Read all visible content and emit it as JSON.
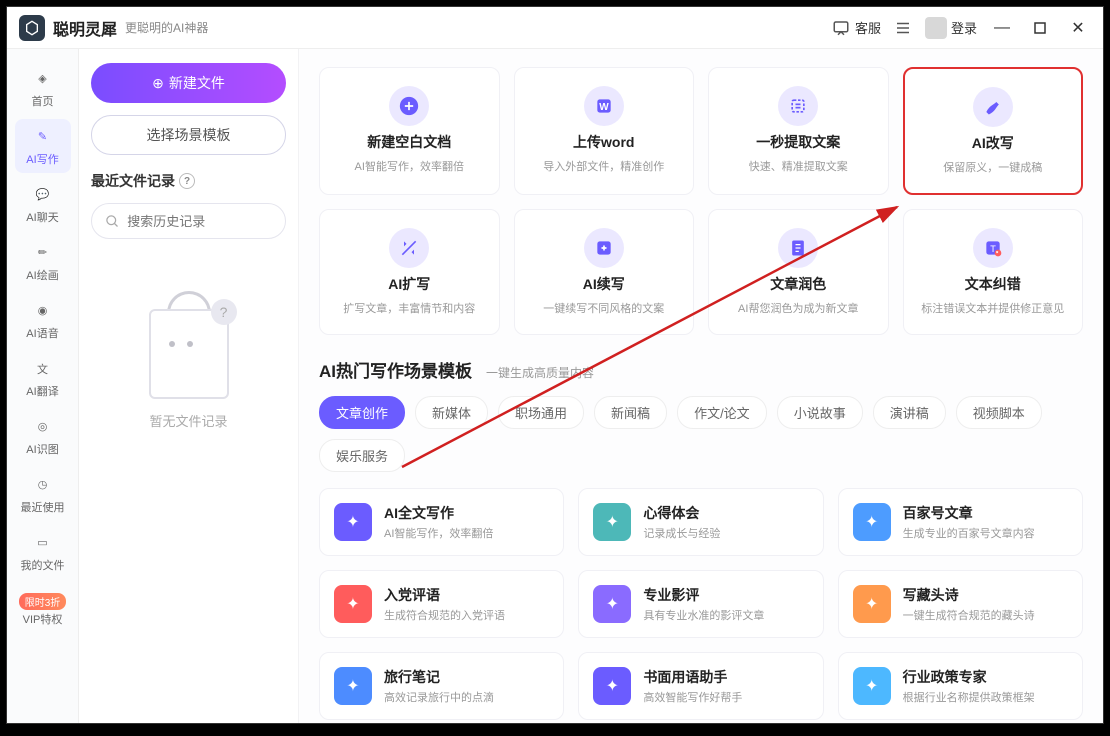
{
  "app": {
    "name": "聪明灵犀",
    "tagline": "更聪明的AI神器"
  },
  "titlebar": {
    "customerService": "客服",
    "login": "登录"
  },
  "sidebar": {
    "items": [
      {
        "label": "首页"
      },
      {
        "label": "AI写作"
      },
      {
        "label": "AI聊天"
      },
      {
        "label": "AI绘画"
      },
      {
        "label": "AI语音"
      },
      {
        "label": "AI翻译"
      },
      {
        "label": "AI识图"
      },
      {
        "label": "最近使用"
      },
      {
        "label": "我的文件"
      },
      {
        "label": "VIP特权"
      }
    ],
    "badge": "限时3折"
  },
  "leftpanel": {
    "newFile": "新建文件",
    "chooseTemplate": "选择场景模板",
    "recentHeader": "最近文件记录",
    "searchPlaceholder": "搜索历史记录",
    "emptyText": "暂无文件记录"
  },
  "actionCards": [
    {
      "title": "新建空白文档",
      "desc": "AI智能写作，效率翻倍",
      "icon": "plus"
    },
    {
      "title": "上传word",
      "desc": "导入外部文件，精准创作",
      "icon": "word"
    },
    {
      "title": "一秒提取文案",
      "desc": "快速、精准提取文案",
      "icon": "extract"
    },
    {
      "title": "AI改写",
      "desc": "保留原义，一键成稿",
      "icon": "rewrite",
      "highlight": true
    },
    {
      "title": "AI扩写",
      "desc": "扩写文章，丰富情节和内容",
      "icon": "expand"
    },
    {
      "title": "AI续写",
      "desc": "一键续写不同风格的文案",
      "icon": "continue"
    },
    {
      "title": "文章润色",
      "desc": "AI帮您润色为成为新文章",
      "icon": "polish"
    },
    {
      "title": "文本纠错",
      "desc": "标注错误文本并提供修正意见",
      "icon": "correct"
    }
  ],
  "section": {
    "title": "AI热门写作场景模板",
    "subtitle": "一键生成高质量内容"
  },
  "tabs": [
    "文章创作",
    "新媒体",
    "职场通用",
    "新闻稿",
    "作文/论文",
    "小说故事",
    "演讲稿",
    "视频脚本",
    "娱乐服务"
  ],
  "activeTab": 0,
  "templates": [
    {
      "title": "AI全文写作",
      "desc": "AI智能写作，效率翻倍",
      "color": "#6b5cff"
    },
    {
      "title": "心得体会",
      "desc": "记录成长与经验",
      "color": "#4db8b8"
    },
    {
      "title": "百家号文章",
      "desc": "生成专业的百家号文章内容",
      "color": "#4d9cff"
    },
    {
      "title": "入党评语",
      "desc": "生成符合规范的入党评语",
      "color": "#ff5c5c"
    },
    {
      "title": "专业影评",
      "desc": "具有专业水准的影评文章",
      "color": "#8a6bff"
    },
    {
      "title": "写藏头诗",
      "desc": "一键生成符合规范的藏头诗",
      "color": "#ff9a4d"
    },
    {
      "title": "旅行笔记",
      "desc": "高效记录旅行中的点滴",
      "color": "#4d8cff"
    },
    {
      "title": "书面用语助手",
      "desc": "高效智能写作好帮手",
      "color": "#6b5cff"
    },
    {
      "title": "行业政策专家",
      "desc": "根据行业名称提供政策框架",
      "color": "#4db8ff"
    }
  ]
}
